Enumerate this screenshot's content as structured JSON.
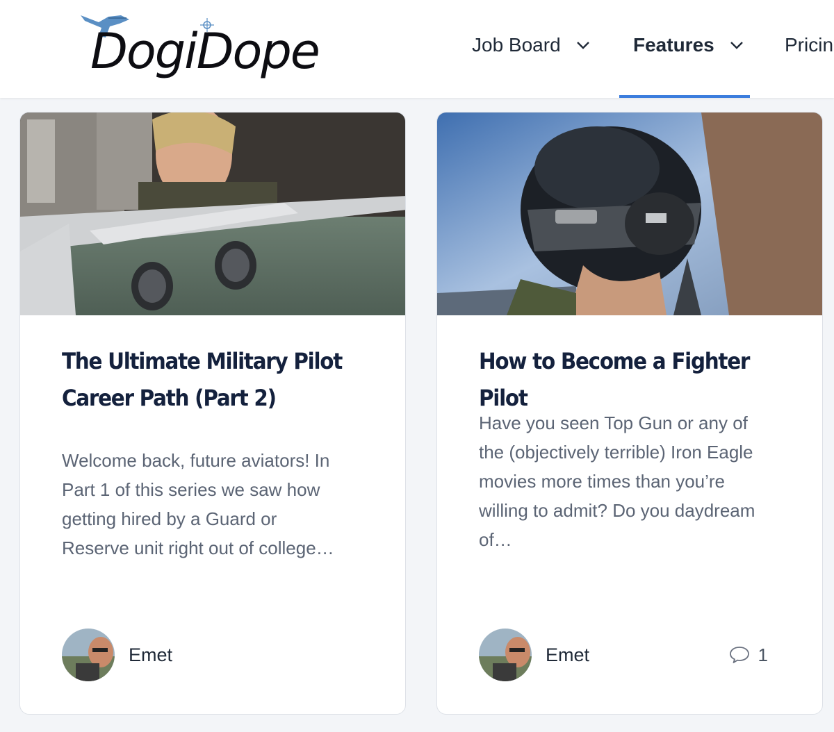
{
  "header": {
    "logo_text": "DogiDope",
    "nav": [
      {
        "label": "Job Board",
        "has_dropdown": true,
        "active": false
      },
      {
        "label": "Features",
        "has_dropdown": true,
        "active": true
      },
      {
        "label": "Pricin",
        "has_dropdown": false,
        "active": false
      }
    ]
  },
  "colors": {
    "accent": "#3b7ddd",
    "title": "#14213d",
    "excerpt": "#5b6474",
    "page_background": "#f3f5f8"
  },
  "cards": [
    {
      "image": "tanker-boom-operator-photo",
      "title_line1": "The Ultimate Military Pilot",
      "title_line2": "Career Path (Part 2)",
      "excerpt_lines": [
        "Welcome back, future aviators! In",
        "Part 1 of this series we saw how",
        "getting hired by a Guard or",
        "Reserve unit right out of college…"
      ],
      "author": "Emet",
      "comment_count": null
    },
    {
      "image": "fighter-pilot-helmet-photo",
      "title_line1": "How to Become a Fighter Pilot",
      "title_line2": "",
      "excerpt_lines": [
        "Have you seen Top Gun or any of",
        "the (objectively terrible) Iron Eagle",
        "movies more times than you’re",
        "willing to admit? Do you daydream",
        "of…"
      ],
      "author": "Emet",
      "comment_count": "1"
    }
  ],
  "icons": [
    "plane-logo-icon",
    "drone-logo-icon",
    "chevron-down-icon",
    "comment-icon"
  ]
}
